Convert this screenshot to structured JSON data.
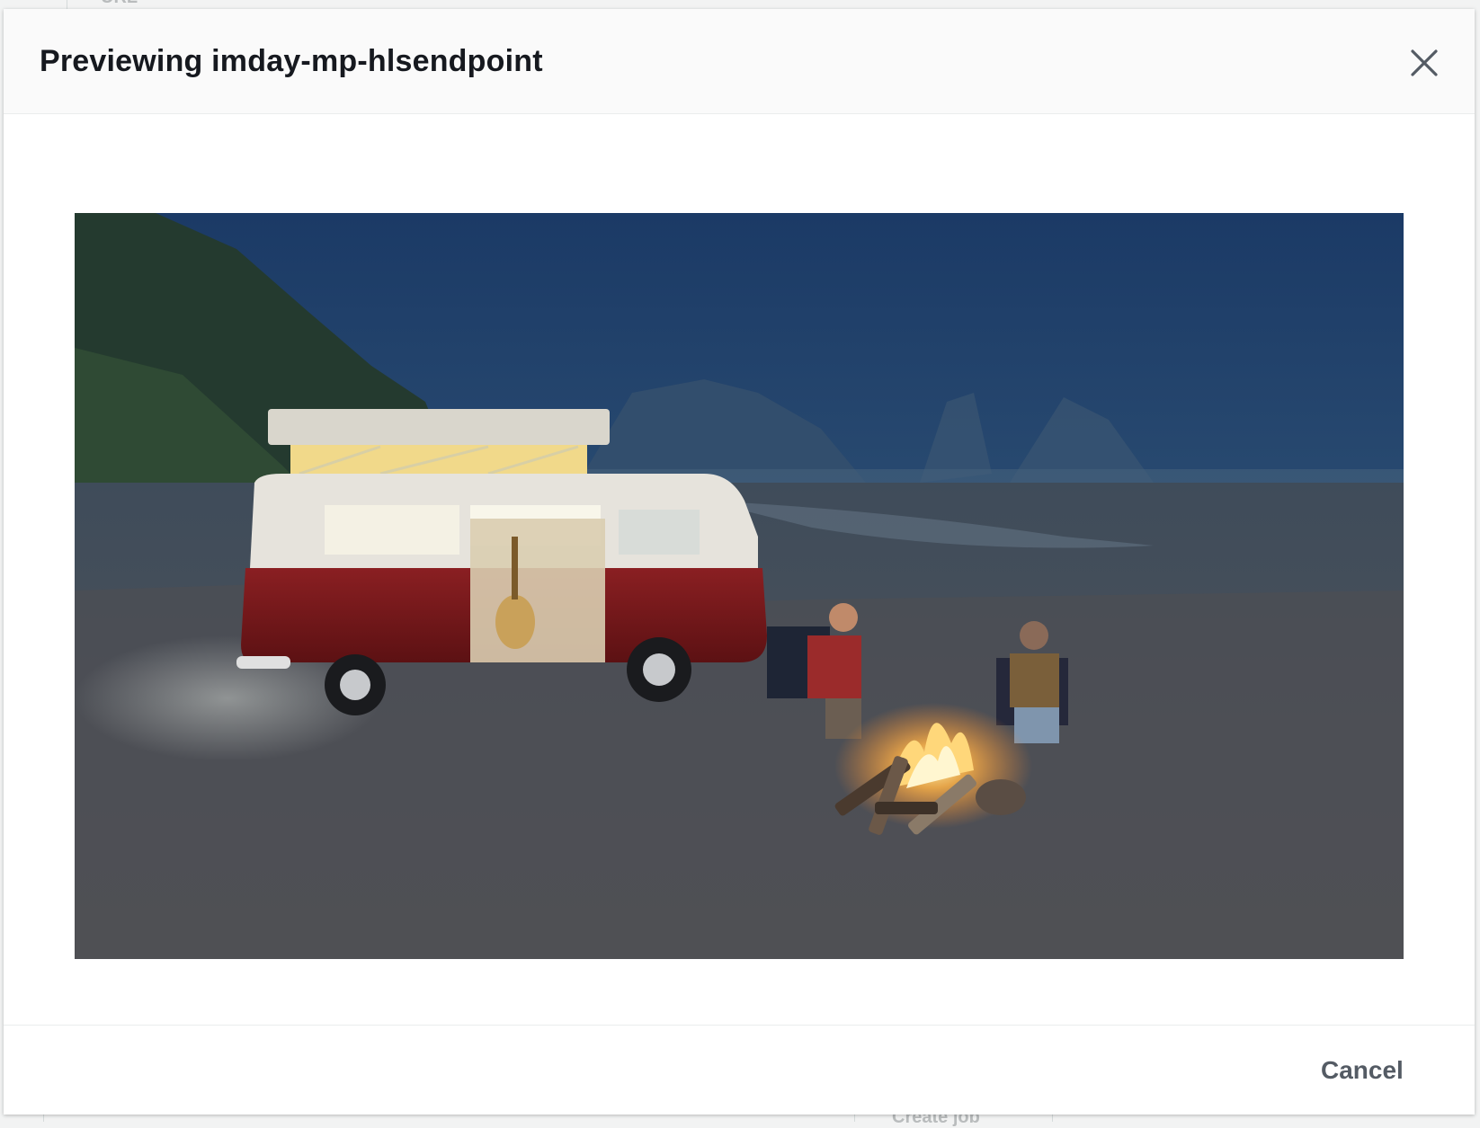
{
  "modal": {
    "title": "Previewing imday-mp-hlsendpoint",
    "close_icon": "close-icon",
    "cancel_label": "Cancel"
  },
  "background": {
    "top_text": "URL",
    "bottom_text": "Create job"
  },
  "video": {
    "description_icon": "video-frame"
  },
  "colors": {
    "title_text": "#16191f",
    "secondary_button_text": "#545b64",
    "header_bg": "#fafafa",
    "divider": "#eaeded"
  }
}
